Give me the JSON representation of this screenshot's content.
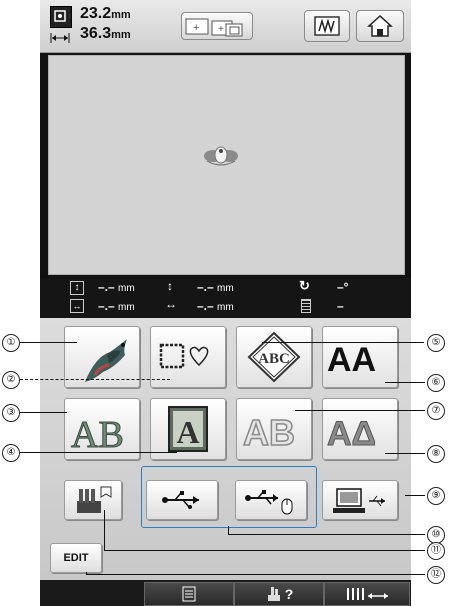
{
  "size": {
    "height_value": "23.2",
    "width_value": "36.3",
    "unit": "mm"
  },
  "info": {
    "height": "–.–",
    "vert": "–.–",
    "width": "–.–",
    "horiz": "–.–",
    "unit": "mm",
    "angle": "–°",
    "bobbin": "–"
  },
  "buttons": {
    "edit_label": "EDIT",
    "help_label": "?"
  },
  "callouts": {
    "n1": "①",
    "n2": "②",
    "n3": "③",
    "n4": "④",
    "n5": "⑤",
    "n6": "⑥",
    "n7": "⑦",
    "n8": "⑧",
    "n9": "⑨",
    "n10": "⑩",
    "n11": "⑪",
    "n12": "⑫"
  },
  "pattern_text": {
    "monogram": "ABC",
    "alpha_a": "AA",
    "alpha_ab": "AB",
    "frame_a": "A",
    "outline_ab": "AB",
    "alpha_delta": "AΔ"
  },
  "colors": {
    "screen": "#121212",
    "preview": "#d3d3d3",
    "button_area": "#d0d0d0"
  }
}
